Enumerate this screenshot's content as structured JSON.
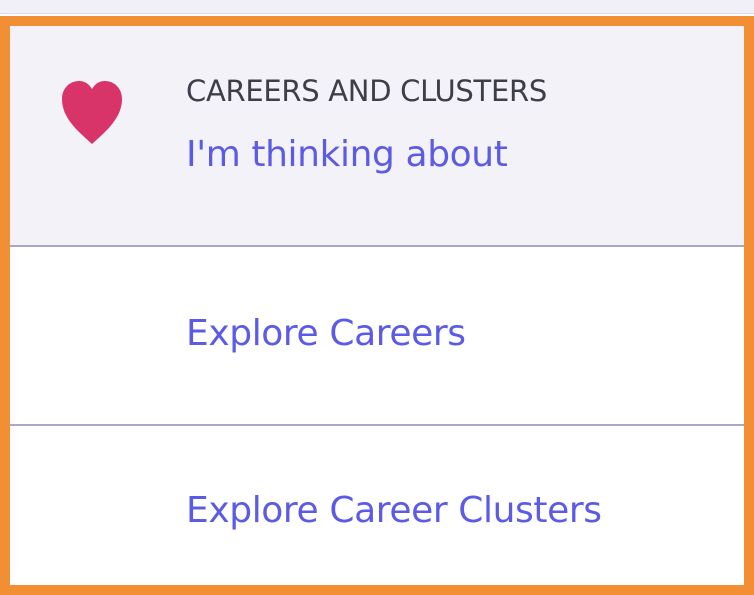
{
  "menu": {
    "header": {
      "icon": "heart-icon",
      "icon_color": "#d9346a",
      "label": "CAREERS AND CLUSTERS",
      "link": "I'm thinking about"
    },
    "items": [
      {
        "label": "Explore Careers"
      },
      {
        "label": "Explore Career Clusters"
      }
    ]
  },
  "colors": {
    "accent": "#5b5be5",
    "focus_border": "#f28e34",
    "header_background": "#f3f2f8",
    "divider": "#a9a7c6"
  }
}
